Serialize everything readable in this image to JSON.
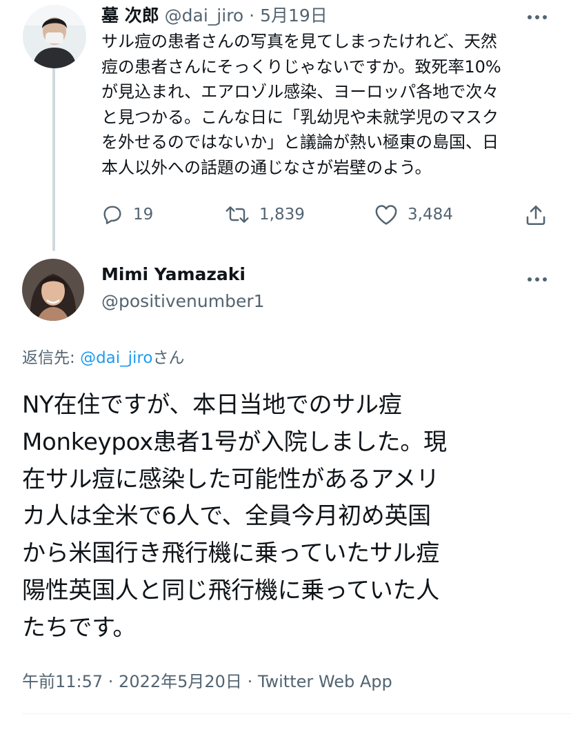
{
  "parent_tweet": {
    "author_name": "墓 次郎",
    "handle": "@dai_jiro",
    "separator": " · ",
    "date": "5月19日",
    "text": "サル痘の患者さんの写真を見てしまったけれど、天然\n痘の患者さんにそっくりじゃないですか。致死率10%\nが見込まれ、エアロゾル感染、ヨーロッパ各地で次々\nと見つかる。こんな日に「乳幼児や未就学児のマスク\nを外せるのではないか」と議論が熱い極東の島国、日\n本人以外への話題の通じなさが岩壁のよう。",
    "reply_count": "19",
    "retweet_count": "1,839",
    "like_count": "3,484"
  },
  "main_tweet": {
    "author_name": "Mimi Yamazaki",
    "handle": "@positivenumber1",
    "reply_prefix": "返信先: ",
    "reply_link": "@dai_jiro",
    "reply_suffix": "さん",
    "text": "NY在住ですが、本日当地でのサル痘\nMonkeypox患者1号が入院しました。現\n在サル痘に感染した可能性があるアメリ\nカ人は全米で6人で、全員今月初め英国\nから米国行き飛行機に乗っていたサル痘\n陽性英国人と同じ飛行機に乗っていた人\nたちです。",
    "timestamp": "午前11:57 · 2022年5月20日 · Twitter Web App"
  },
  "icons": {
    "reply": "reply-icon",
    "retweet": "retweet-icon",
    "like": "heart-icon",
    "share": "share-icon",
    "more": "more-icon"
  },
  "colors": {
    "text_primary": "#0f1419",
    "text_secondary": "#536471",
    "link": "#1d9bf0",
    "thread_line": "#cfd9de"
  }
}
